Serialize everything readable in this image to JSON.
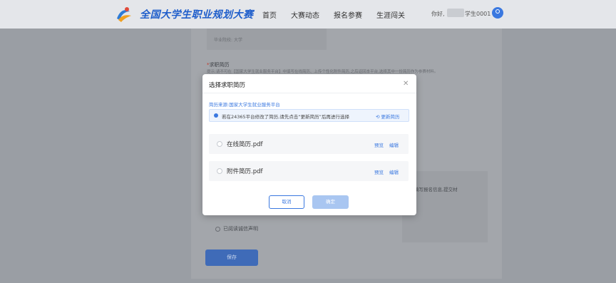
{
  "header": {
    "site_title": "全国大学生职业规划大赛",
    "nav": [
      "首页",
      "大赛动态",
      "报名参赛",
      "生涯闯关"
    ],
    "greeting": "你好,",
    "user_suffix": "学生0001"
  },
  "background": {
    "school_label": "毕业院校:",
    "school_value": "大学",
    "section_title": "求职简历",
    "section_hint": "提示:请不可在【国家大学生就业服务平台】中填写在线简历、上传个性化附件简历,之后返回本平台,选择其中一份简历作为参赛材料。",
    "fill_hint": "编辑填写报名信息,提交材",
    "agree_label": "已阅读诚信声明",
    "save_button": "保存"
  },
  "modal": {
    "title": "选择求职简历",
    "source": "简历来源:国家大学生就业服务平台",
    "notice": "若在24365平台修改了简历,请先点击“更新简历”后再进行选择",
    "refresh": "更新简历",
    "resumes": [
      {
        "name": "在线简历.pdf",
        "preview": "预览",
        "edit": "编辑"
      },
      {
        "name": "附件简历.pdf",
        "preview": "预览",
        "edit": "编辑"
      }
    ],
    "cancel": "取消",
    "confirm": "确定"
  },
  "colors": {
    "accent": "#3a78e0",
    "overlay": "#9a9ea4",
    "confirm_disabled": "#a9c6f1"
  }
}
